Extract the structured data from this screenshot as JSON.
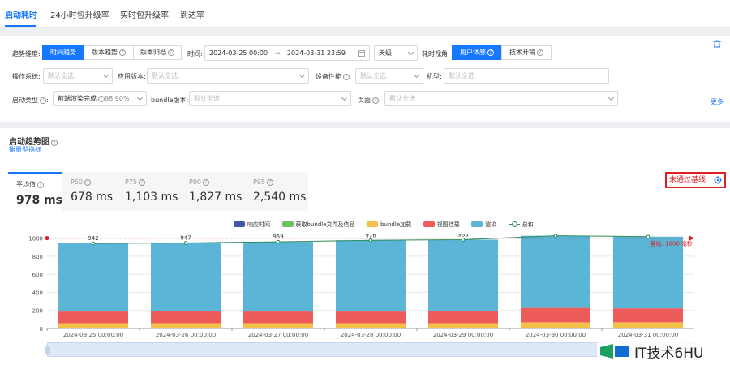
{
  "top_tabs": [
    {
      "label": "启动耗时",
      "active": true
    },
    {
      "label": "24小时包升级率",
      "active": false
    },
    {
      "label": "实时包升级率",
      "active": false
    },
    {
      "label": "到达率",
      "active": false
    }
  ],
  "filters": {
    "trend_dimension": {
      "label": "趋势维度:",
      "options": [
        "时间趋势",
        "版本趋势",
        "版本归档"
      ],
      "selected": "时间趋势"
    },
    "time": {
      "label": "时间:",
      "start": "2024-03-25 00:00",
      "end": "2024-03-31 23:59",
      "arrow": "→"
    },
    "granularity": {
      "value": "天级"
    },
    "perspective": {
      "label": "耗时视角:",
      "options": [
        "用户体感",
        "技术开销"
      ],
      "selected": "用户体感"
    },
    "os": {
      "label": "操作系统:",
      "placeholder": "默认全选"
    },
    "app_version": {
      "label": "应用版本:",
      "placeholder": "默认全选"
    },
    "device_perf": {
      "label": "设备性能",
      "placeholder": "默认全选"
    },
    "model": {
      "label": "机型:",
      "placeholder": "默认全选"
    },
    "startup_type": {
      "label": "启动类型",
      "value": "前端渲染完成",
      "percent": "98.90%"
    },
    "bundle_version": {
      "label": "bundle版本:",
      "placeholder": "默认全选"
    },
    "page": {
      "label": "页面",
      "placeholder": "默认全选"
    },
    "more_label": "更多"
  },
  "card": {
    "title": "启动趋势图",
    "subtitle": "衡量型指标",
    "baseline_status": "未通过基线",
    "metrics": [
      {
        "label": "平均值",
        "value": "978 ms",
        "active": true
      },
      {
        "label": "P50",
        "value": "678 ms",
        "active": false
      },
      {
        "label": "P75",
        "value": "1,103 ms",
        "active": false
      },
      {
        "label": "P90",
        "value": "1,827 ms",
        "active": false
      },
      {
        "label": "P95",
        "value": "2,540 ms",
        "active": false
      }
    ]
  },
  "colors": {
    "accent": "#1677ff",
    "response": "#3b5ba5",
    "bundle_fetch": "#6cc26c",
    "bundle_load": "#f5c04a",
    "view_mount": "#ee5b5b",
    "render": "#5ab5d6",
    "total": "#2e8b57",
    "baseline": "#e02020"
  },
  "chart_data": {
    "type": "bar",
    "stacked": true,
    "categories": [
      "2024-03-25 00:00:00",
      "2024-03-26 00:00:00",
      "2024-03-27 00:00:00",
      "2024-03-28 00:00:00",
      "2024-03-29 00:00:00",
      "2024-03-30 00:00:00",
      "2024-03-31 00:00:00"
    ],
    "series": [
      {
        "name": "响应时间",
        "values": [
          3,
          3,
          3,
          3,
          3,
          3,
          3
        ],
        "color": "#3b5ba5"
      },
      {
        "name": "获取bundle文件及信息",
        "values": [
          5,
          5,
          5,
          5,
          5,
          5,
          5
        ],
        "color": "#6cc26c"
      },
      {
        "name": "bundle加载",
        "values": [
          50,
          50,
          50,
          50,
          50,
          60,
          60
        ],
        "color": "#f5c04a"
      },
      {
        "name": "视图挂载",
        "values": [
          130,
          135,
          130,
          130,
          140,
          160,
          155
        ],
        "color": "#ee5b5b"
      },
      {
        "name": "渲染",
        "values": [
          754,
          754,
          771,
          788,
          785,
          798,
          793
        ],
        "color": "#5ab5d6"
      }
    ],
    "line": {
      "name": "总和",
      "values": [
        942,
        947,
        959,
        976,
        983,
        1026,
        1016
      ],
      "color": "#2e8b57"
    },
    "data_labels": [
      "942",
      "947",
      "959",
      "976",
      "983",
      "1026",
      "1016"
    ],
    "baseline": {
      "value": 1000,
      "label": "基线: 1000 毫秒"
    },
    "ylim": [
      0,
      1050
    ],
    "yticks": [
      0,
      200,
      400,
      600,
      800,
      1000
    ],
    "ytick_labels": [
      "0",
      "200",
      "400",
      "600",
      "800",
      "1000"
    ],
    "legend_position": "top-center",
    "grid": true
  },
  "watermark": {
    "text": "IT技术6HU"
  }
}
